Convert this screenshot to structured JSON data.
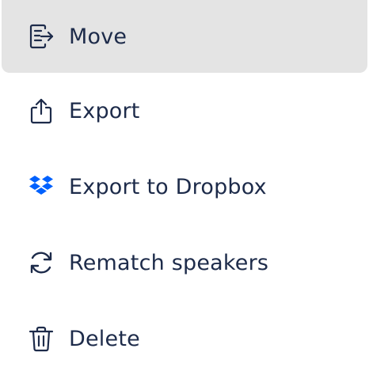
{
  "menu": {
    "items": [
      {
        "label": "Move",
        "icon": "move-icon",
        "active": true
      },
      {
        "label": "Export",
        "icon": "export-icon",
        "active": false
      },
      {
        "label": "Export to Dropbox",
        "icon": "dropbox-icon",
        "active": false
      },
      {
        "label": "Rematch speakers",
        "icon": "rematch-icon",
        "active": false
      },
      {
        "label": "Delete",
        "icon": "trash-icon",
        "active": false
      }
    ]
  },
  "colors": {
    "text": "#1d2b4a",
    "active_bg": "#e4e4e4",
    "dropbox": "#0061fe"
  }
}
